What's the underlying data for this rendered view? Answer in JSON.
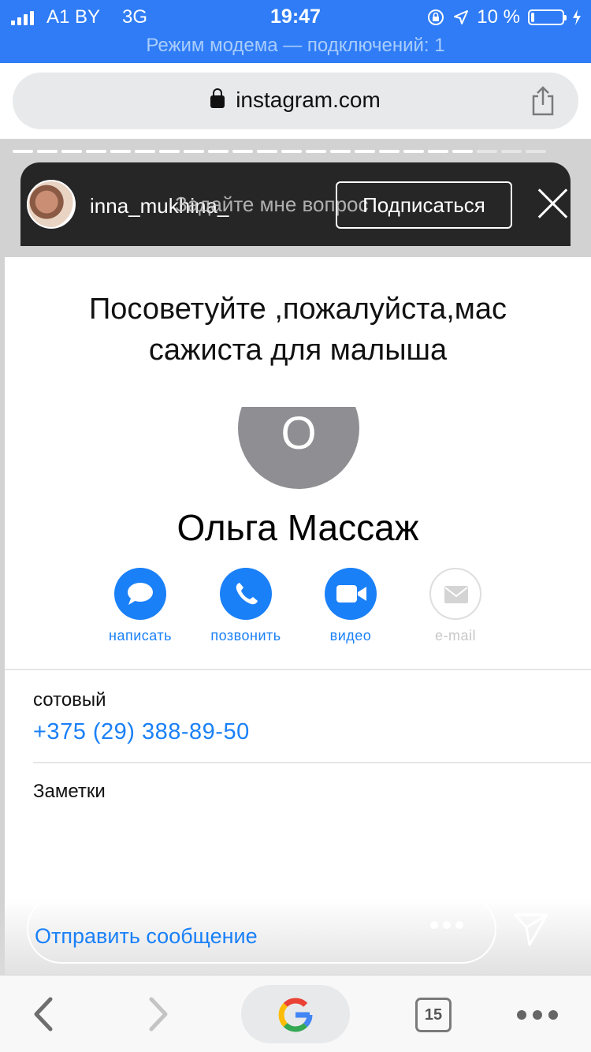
{
  "status_bar": {
    "carrier": "A1 BY",
    "network": "3G",
    "time": "19:47",
    "battery": "10 %",
    "battery_level": 0.1,
    "hotspot_text": "Режим модема — подключений: 1"
  },
  "browser": {
    "url": "instagram.com",
    "tab_count": "15"
  },
  "story": {
    "username": "inna_mukhina_",
    "question_overlay": "Задайте мне вопрос",
    "subscribe_label": "Подписаться",
    "progress_segments_total": 22,
    "progress_segments_viewed": 19
  },
  "contact_card": {
    "caption": "Посоветуйте ,пожалуйста,мас сажиста для малыша",
    "avatar_letter": "О",
    "name": "Ольга Массаж",
    "actions": [
      {
        "label": "написать",
        "icon": "message-icon",
        "enabled": true
      },
      {
        "label": "позвонить",
        "icon": "phone-icon",
        "enabled": true
      },
      {
        "label": "видео",
        "icon": "video-icon",
        "enabled": true
      },
      {
        "label": "e-mail",
        "icon": "mail-icon",
        "enabled": false
      }
    ],
    "phone_label": "сотовый",
    "phone_number": "+375 (29) 388-89-50",
    "notes_label": "Заметки"
  },
  "composer": {
    "placeholder": "Отправить сообщение"
  },
  "colors": {
    "status_bar": "#2f7cf6",
    "accent": "#1a80f8",
    "story_header": "#262626"
  }
}
